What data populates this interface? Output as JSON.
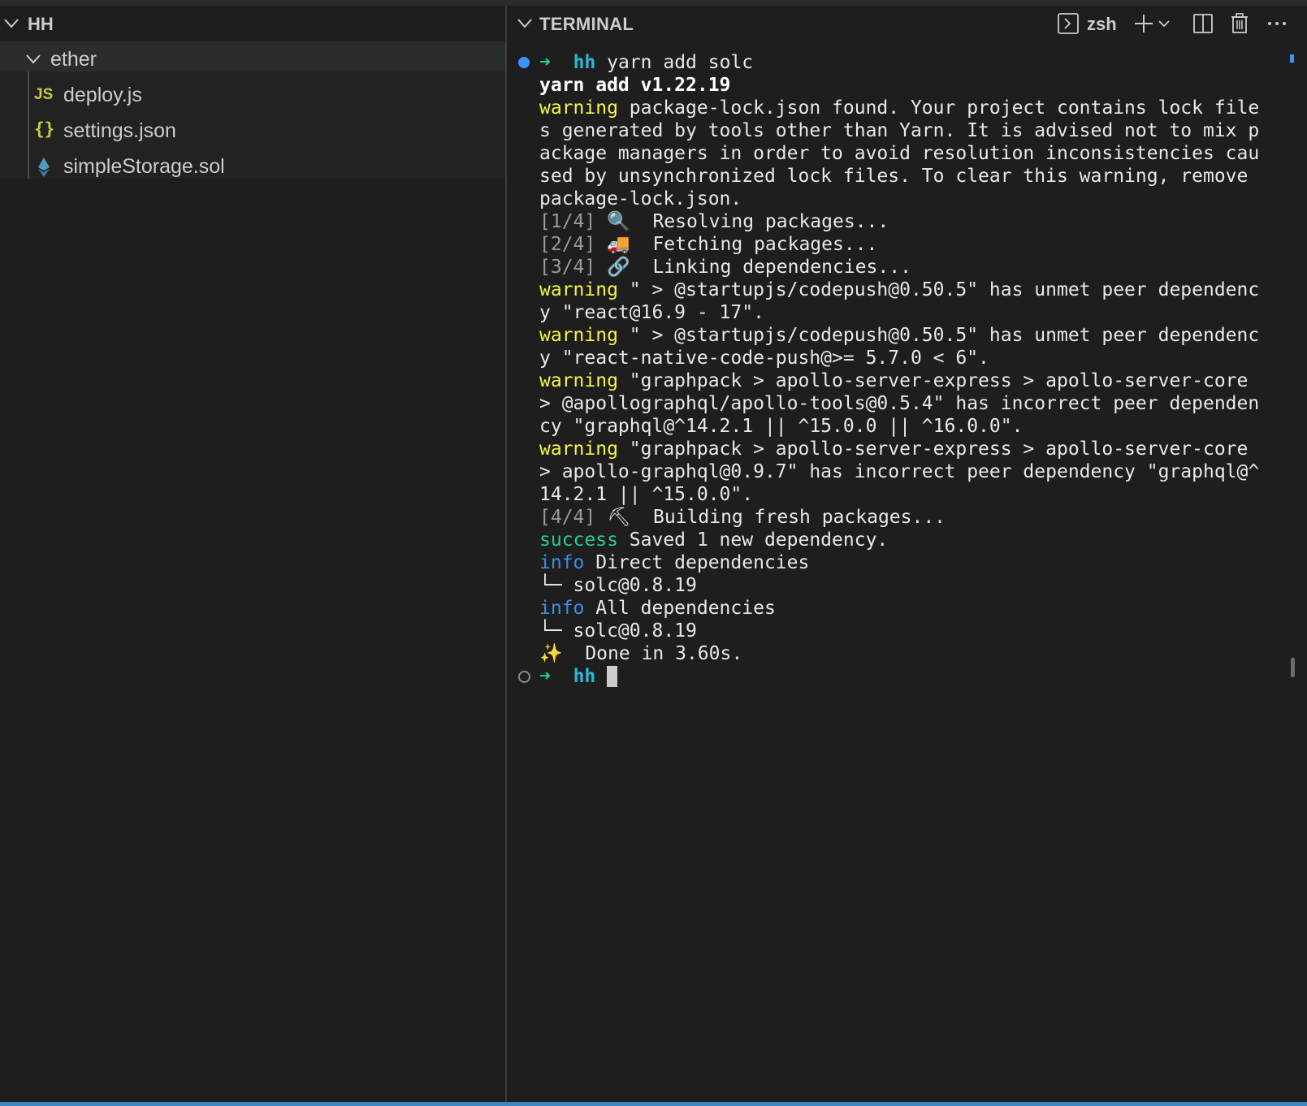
{
  "explorer": {
    "title": "HH",
    "folder": "ether",
    "files": [
      {
        "name": "deploy.js",
        "icon": "JS"
      },
      {
        "name": "settings.json",
        "icon": "{}"
      },
      {
        "name": "simpleStorage.sol",
        "icon": "ethereum-icon"
      }
    ]
  },
  "terminal": {
    "title": "TERMINAL",
    "shell": "zsh",
    "prompt": {
      "arrow": "➜",
      "cwd": "hh",
      "command": "yarn add solc"
    },
    "lines": [
      {
        "text": "yarn add v1.22.19"
      },
      {
        "label": "warning",
        "text": " package-lock.json found. Your project contains lock file"
      },
      {
        "text": "s generated by tools other than Yarn. It is advised not to mix p"
      },
      {
        "text": "ackage managers in order to avoid resolution inconsistencies cau"
      },
      {
        "text": "sed by unsynchronized lock files. To clear this warning, remove"
      },
      {
        "text": "package-lock.json."
      },
      {
        "step": "[1/4]",
        "emoji": "🔍",
        "text": "  Resolving packages..."
      },
      {
        "step": "[2/4]",
        "emoji": "🚚",
        "text": "  Fetching packages..."
      },
      {
        "step": "[3/4]",
        "emoji": "🔗",
        "text": "  Linking dependencies..."
      },
      {
        "label": "warning",
        "text": " \" > @startupjs/codepush@0.50.5\" has unmet peer dependenc"
      },
      {
        "text": "y \"react@16.9 - 17\"."
      },
      {
        "label": "warning",
        "text": " \" > @startupjs/codepush@0.50.5\" has unmet peer dependenc"
      },
      {
        "text": "y \"react-native-code-push@>= 5.7.0 < 6\"."
      },
      {
        "label": "warning",
        "text": " \"graphpack > apollo-server-express > apollo-server-core"
      },
      {
        "text": "> @apollographql/apollo-tools@0.5.4\" has incorrect peer dependen"
      },
      {
        "text": "cy \"graphql@^14.2.1 || ^15.0.0 || ^16.0.0\"."
      },
      {
        "label": "warning",
        "text": " \"graphpack > apollo-server-express > apollo-server-core"
      },
      {
        "text": "> apollo-graphql@0.9.7\" has incorrect peer dependency \"graphql@^"
      },
      {
        "text": "14.2.1 || ^15.0.0\"."
      },
      {
        "step": "[4/4]",
        "emoji": "⛏",
        "text": "  Building fresh packages..."
      },
      {
        "label": "success",
        "text": " Saved 1 new dependency."
      },
      {
        "label": "info",
        "text": " Direct dependencies"
      },
      {
        "text": "└─ solc@0.8.19"
      },
      {
        "label": "info",
        "text": " All dependencies"
      },
      {
        "text": "└─ solc@0.8.19"
      },
      {
        "emoji": "✨",
        "text": "  Done in 3.60s."
      }
    ],
    "final_prompt": {
      "arrow": "➜",
      "cwd": "hh"
    }
  }
}
